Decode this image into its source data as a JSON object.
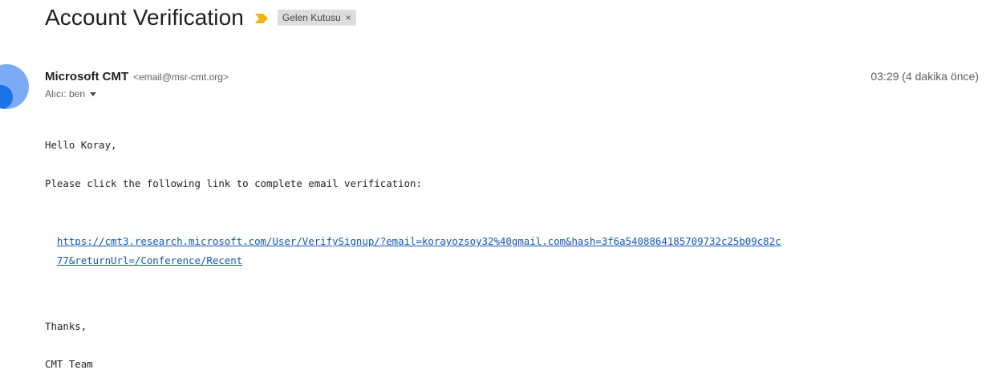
{
  "email": {
    "subject": "Account Verification",
    "importance_icon": "importance-arrow-icon",
    "label_chip": {
      "text": "Gelen Kutusu",
      "close_glyph": "×"
    },
    "sender": {
      "name": "Microsoft CMT",
      "address": "<email@msr-cmt.org>"
    },
    "recipient_text": "Alıcı: ben",
    "timestamp": "03:29 (4 dakika önce)",
    "body": {
      "greeting": "Hello Koray,",
      "instruction": "Please click the following link to complete email verification:",
      "link_line1": "https://cmt3.research.microsoft.com/User/VerifySignup/?email=korayozsoy32%40gmail.com&hash=3f6a5408864185709732c25b09c82c",
      "link_line2": "77&returnUrl=/Conference/Recent",
      "thanks": "Thanks,",
      "signature": "CMT Team"
    }
  },
  "colors": {
    "importance": "#f4b400",
    "link": "#1155cc",
    "avatar": "#7baaf7"
  }
}
